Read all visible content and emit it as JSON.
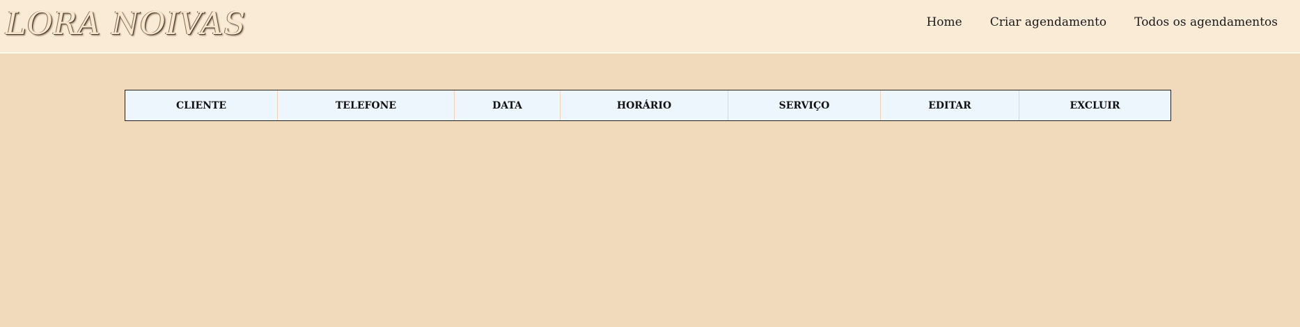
{
  "header": {
    "logo": "LORA NOIVAS",
    "nav": [
      {
        "label": "Home"
      },
      {
        "label": "Criar agendamento"
      },
      {
        "label": "Todos os agendamentos"
      }
    ]
  },
  "table": {
    "columns": [
      "CLIENTE",
      "TELEFONE",
      "DATA",
      "HORÁRIO",
      "SERVIÇO",
      "EDITAR",
      "EXCLUIR"
    ],
    "rows": []
  },
  "colors": {
    "page_background": "#f1dabb",
    "navbar_background": "#faebd7",
    "table_header_background": "#eef6fd",
    "table_border": "#1e1e1e"
  }
}
